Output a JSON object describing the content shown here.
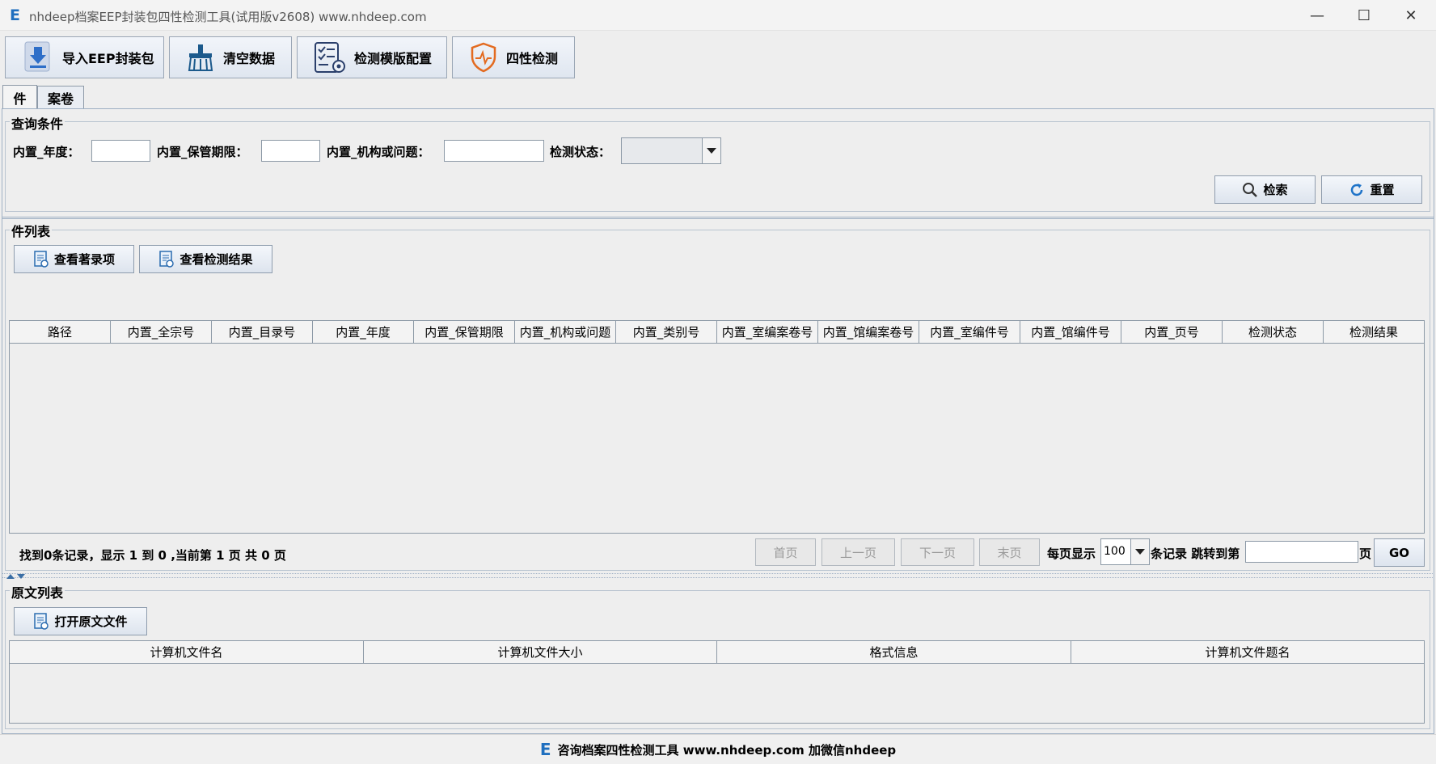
{
  "window": {
    "logo": "E",
    "title": "nhdeep档案EEP封装包四性检测工具(试用版v2608) www.nhdeep.com",
    "minimize": "—",
    "maximize": "☐",
    "close": "✕"
  },
  "toolbar": {
    "import_label": "导入EEP封装包",
    "clear_label": "清空数据",
    "template_label": "检测模版配置",
    "check_label": "四性检测"
  },
  "tabs": [
    {
      "label": "件",
      "active": true
    },
    {
      "label": "案卷",
      "active": false
    }
  ],
  "query": {
    "legend": "查询条件",
    "year_label": "内置_年度：",
    "retention_label": "内置_保管期限：",
    "org_label": "内置_机构或问题：",
    "status_label": "检测状态：",
    "status_value": "",
    "search_label": "检索",
    "reset_label": "重置"
  },
  "items": {
    "legend": "件列表",
    "view_catalog_label": "查看著录项",
    "view_result_label": "查看检测结果",
    "columns": [
      "路径",
      "内置_全宗号",
      "内置_目录号",
      "内置_年度",
      "内置_保管期限",
      "内置_机构或问题",
      "内置_类别号",
      "内置_室编案卷号",
      "内置_馆编案卷号",
      "内置_室编件号",
      "内置_馆编件号",
      "内置_页号",
      "检测状态",
      "检测结果"
    ],
    "rows": []
  },
  "pagination": {
    "summary": "找到0条记录，显示 1 到 0 ,当前第 1 页 共 0 页",
    "first": "首页",
    "prev": "上一页",
    "next": "下一页",
    "last": "末页",
    "per_page_label": "每页显示",
    "per_page_value": "100",
    "records_jump_label": "条记录 跳转到第",
    "page_value": "",
    "page_suffix": "页",
    "go": "GO"
  },
  "originals": {
    "legend": "原文列表",
    "open_label": "打开原文文件",
    "columns": [
      "计算机文件名",
      "计算机文件大小",
      "格式信息",
      "计算机文件题名"
    ],
    "rows": []
  },
  "footer": {
    "logo": "E",
    "text": "咨询档案四性检测工具 www.nhdeep.com 加微信nhdeep"
  }
}
